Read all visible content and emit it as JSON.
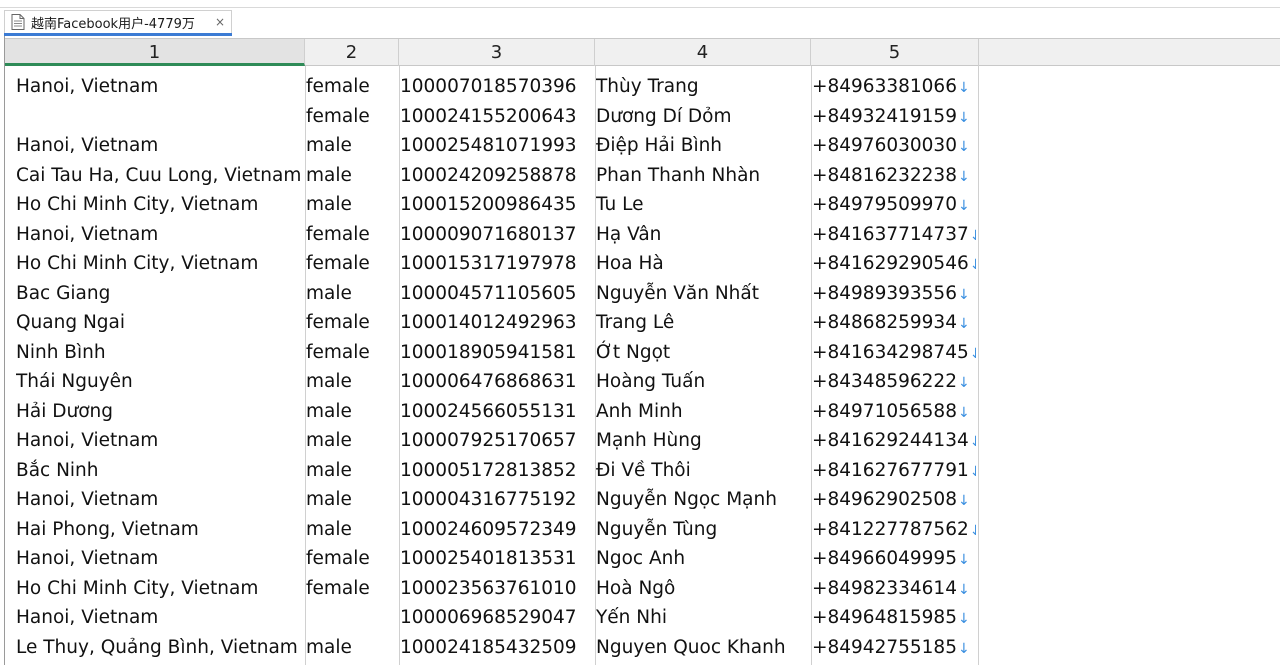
{
  "tab": {
    "title": "越南Facebook用户-4779万",
    "close": "×"
  },
  "columns": [
    "1",
    "2",
    "3",
    "4",
    "5"
  ],
  "arrow_glyph": "↓",
  "rows": [
    [
      "Hanoi, Vietnam",
      "female",
      "100007018570396",
      "Thùy Trang",
      "+84963381066"
    ],
    [
      "",
      "female",
      "100024155200643",
      "Dương Dí Dỏm",
      "+84932419159"
    ],
    [
      "Hanoi, Vietnam",
      "male",
      "100025481071993",
      "Điệp Hải Bình",
      "+84976030030"
    ],
    [
      "Cai Tau Ha, Cuu Long, Vietnam",
      "male",
      "100024209258878",
      "Phan Thanh Nhàn",
      "+84816232238"
    ],
    [
      "Ho Chi Minh City, Vietnam",
      "male",
      "100015200986435",
      "Tu Le",
      "+84979509970"
    ],
    [
      "Hanoi, Vietnam",
      "female",
      "100009071680137",
      "Hạ Vân",
      "+841637714737"
    ],
    [
      "Ho Chi Minh City, Vietnam",
      "female",
      "100015317197978",
      "Hoa Hà",
      "+841629290546"
    ],
    [
      "Bac Giang",
      "male",
      "100004571105605",
      "Nguyễn Văn Nhất",
      "+84989393556"
    ],
    [
      "Quang Ngai",
      "female",
      "100014012492963",
      "Trang Lê",
      "+84868259934"
    ],
    [
      "Ninh Bình",
      "female",
      "100018905941581",
      "Ớt Ngọt",
      "+841634298745"
    ],
    [
      "Thái Nguyên",
      "male",
      "100006476868631",
      "Hoàng Tuấn",
      "+84348596222"
    ],
    [
      "Hải Dương",
      "male",
      "100024566055131",
      "Anh Minh",
      "+84971056588"
    ],
    [
      "Hanoi, Vietnam",
      "male",
      "100007925170657",
      "Mạnh Hùng",
      "+841629244134"
    ],
    [
      "Bắc Ninh",
      "male",
      "100005172813852",
      "Đi Về Thôi",
      "+841627677791"
    ],
    [
      "Hanoi, Vietnam",
      "male",
      "100004316775192",
      "Nguyễn Ngọc Mạnh",
      "+84962902508"
    ],
    [
      "Hai Phong, Vietnam",
      "male",
      "100024609572349",
      "Nguyễn Tùng",
      "+841227787562"
    ],
    [
      "Hanoi, Vietnam",
      "female",
      "100025401813531",
      "Ngoc Anh",
      "+84966049995"
    ],
    [
      "Ho Chi Minh City, Vietnam",
      "female",
      "100023563761010",
      "Hoà Ngô",
      "+84982334614"
    ],
    [
      "Hanoi, Vietnam",
      "",
      "100006968529047",
      "Yến Nhi",
      "+84964815985"
    ],
    [
      "Le Thuy, Quảng Bình, Vietnam",
      "male",
      "100024185432509",
      "Nguyen Quoc Khanh",
      "+84942755185"
    ]
  ]
}
